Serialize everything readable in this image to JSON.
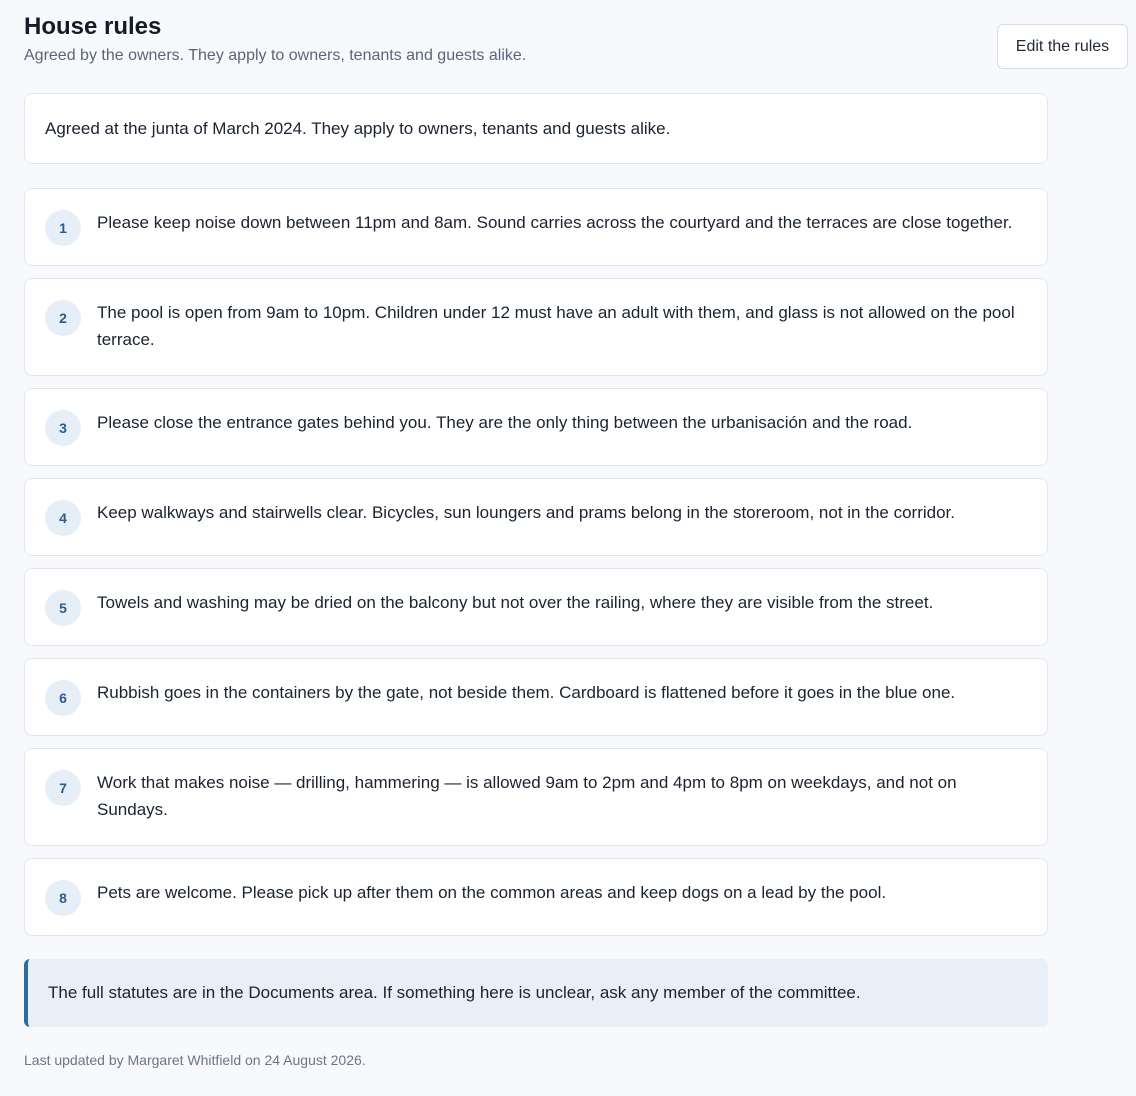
{
  "header": {
    "title": "House rules",
    "subtitle": "Agreed by the owners. They apply to owners, tenants and guests alike.",
    "edit_label": "Edit the rules"
  },
  "intro": "Agreed at the junta of March 2024. They apply to owners, tenants and guests alike.",
  "rules": [
    {
      "number": "1",
      "text": "Please keep noise down between 11pm and 8am. Sound carries across the courtyard and the terraces are close together."
    },
    {
      "number": "2",
      "text": "The pool is open from 9am to 10pm. Children under 12 must have an adult with them, and glass is not allowed on the pool terrace."
    },
    {
      "number": "3",
      "text": "Please close the entrance gates behind you. They are the only thing between the urbanisación and the road."
    },
    {
      "number": "4",
      "text": "Keep walkways and stairwells clear. Bicycles, sun loungers and prams belong in the storeroom, not in the corridor."
    },
    {
      "number": "5",
      "text": "Towels and washing may be dried on the balcony but not over the railing, where they are visible from the street."
    },
    {
      "number": "6",
      "text": "Rubbish goes in the containers by the gate, not beside them. Cardboard is flattened before it goes in the blue one."
    },
    {
      "number": "7",
      "text": "Work that makes noise — drilling, hammering — is allowed 9am to 2pm and 4pm to 8pm on weekdays, and not on Sundays."
    },
    {
      "number": "8",
      "text": "Pets are welcome. Please pick up after them on the common areas and keep dogs on a lead by the pool."
    }
  ],
  "note": "The full statutes are in the Documents area. If something here is unclear, ask any member of the committee.",
  "footer": "Last updated by Margaret Whitfield on 24 August 2026."
}
